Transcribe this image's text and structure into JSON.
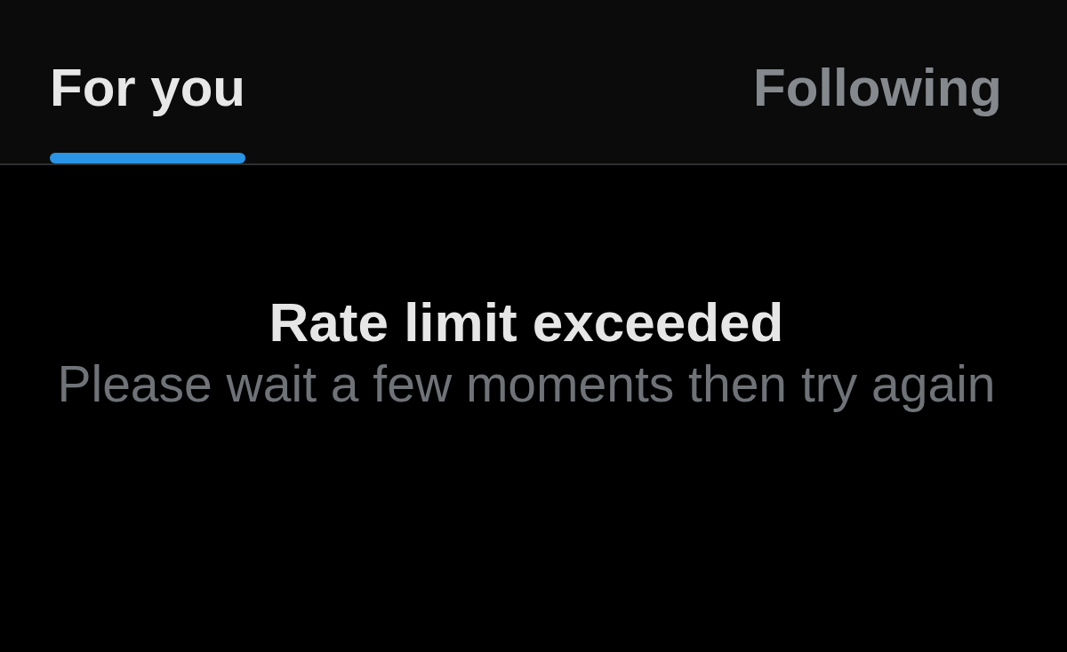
{
  "tabs": [
    {
      "label": "For you",
      "selected": true
    },
    {
      "label": "Following",
      "selected": false
    }
  ],
  "message": {
    "title": "Rate limit exceeded",
    "body": "Please wait a few moments then try again"
  }
}
